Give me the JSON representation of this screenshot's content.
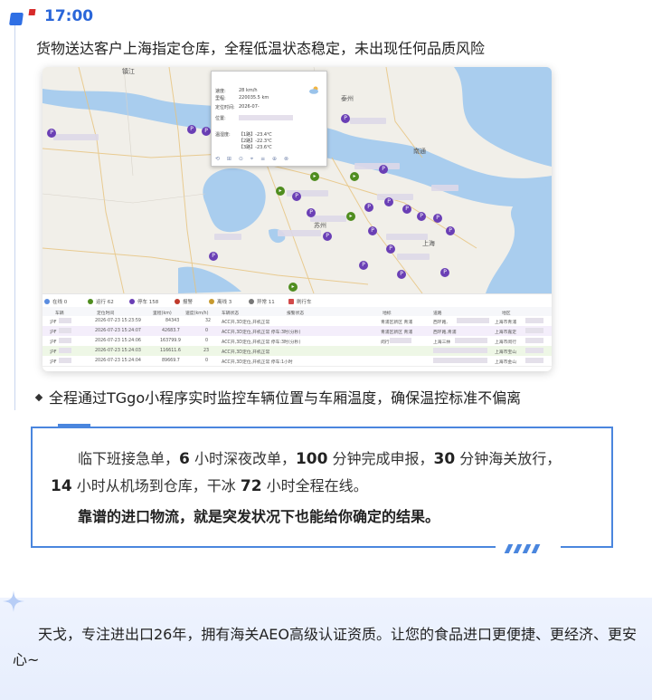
{
  "header": {
    "time": "17:00",
    "caption": "货物送达客户上海指定仓库，全程低温状态稳定，未出现任何品质风险"
  },
  "map": {
    "popup": {
      "speed_label": "速度:",
      "speed_value": "28 km/h",
      "mileage_label": "里程:",
      "mileage_value": "220035.5 km",
      "time_label": "定位时间:",
      "time_value": "2026-07-",
      "location_label": "位置:",
      "temp_label": "温湿度:",
      "temps": [
        "【1路】-23.4℃",
        "【2路】-22.3℃",
        "【3路】-23.6℃"
      ],
      "icons": "⟲ ⊞ ⊙ ⌖ ≡ ⊕ ⊗"
    },
    "place_labels": [
      "镇江",
      "泰州",
      "南通",
      "苏州",
      "上海"
    ],
    "legend": [
      {
        "label": "在线 0",
        "color": "#5b8de0"
      },
      {
        "label": "运行 62",
        "color": "#4f8d1f"
      },
      {
        "label": "停车 158",
        "color": "#6a3fb5"
      },
      {
        "label": "报警",
        "color": "#c0392b"
      },
      {
        "label": "离线 3",
        "color": "#c79a2e"
      },
      {
        "label": "异常 11",
        "color": "#777777"
      },
      {
        "label": "刷行车",
        "color": "#d24a4a"
      }
    ]
  },
  "table": {
    "headers": [
      "车辆",
      "定位时间",
      "里程(km)",
      "速度(km/h)",
      "车辆状态",
      "报警状态",
      "地标",
      "道路",
      "地区"
    ],
    "rows": [
      [
        "沪F",
        "2026-07-23 15:23:59",
        "84343",
        "32",
        "ACC开,3D定位,开机正常",
        "",
        "青浦区新区 青浦",
        "西环路,",
        "上海市青浦"
      ],
      [
        "沪F",
        "2026-07-23 15:24:07",
        "42683.7",
        "0",
        "ACC开,3D定位,开机正常 停车:3时(分秒)",
        "",
        "青浦区新区 青浦",
        "西环路,青浦",
        "上海市嘉定"
      ],
      [
        "沪F",
        "2026-07-23 15:24:06",
        "163799.9",
        "0",
        "ACC开,3D定位,开机正常 停车:3时(分秒)",
        "",
        "闵行",
        "上海三林",
        "上海市闵行"
      ],
      [
        "沪F",
        "2026-07-23 15:24:03",
        "116611.6",
        "23",
        "ACC开,3D定位,开机正常",
        "",
        "",
        "",
        "上海市宝山"
      ],
      [
        "沪F",
        "2026-07-23 15:24:04",
        "89669.7",
        "0",
        "ACC开,3D定位,开机正常 停车:1小时",
        "",
        "",
        "",
        "上海市金山"
      ]
    ]
  },
  "bullet": "全程通过TGgo小程序实时监控车辆位置与车厢温度，确保温控标准不偏离",
  "box": {
    "l1a": "临下班接急单，",
    "n1": "6",
    "l1b": " 小时深夜改单，",
    "n2": "100",
    "l1c": " 分钟完成申报，",
    "n3": "30",
    "l1d": " 分钟海关放行，",
    "n4": "14",
    "l2a": " 小时从机场到仓库，干冰 ",
    "n5": "72",
    "l2b": " 小时全程在线。",
    "highlight": "靠谱的进口物流，就是突发状况下也能给你确定的结果。"
  },
  "footer": {
    "text": "天戈，专注进出口26年，拥有海关AEO高级认证资质。让您的食品进口更便捷、更经济、更安心~"
  }
}
